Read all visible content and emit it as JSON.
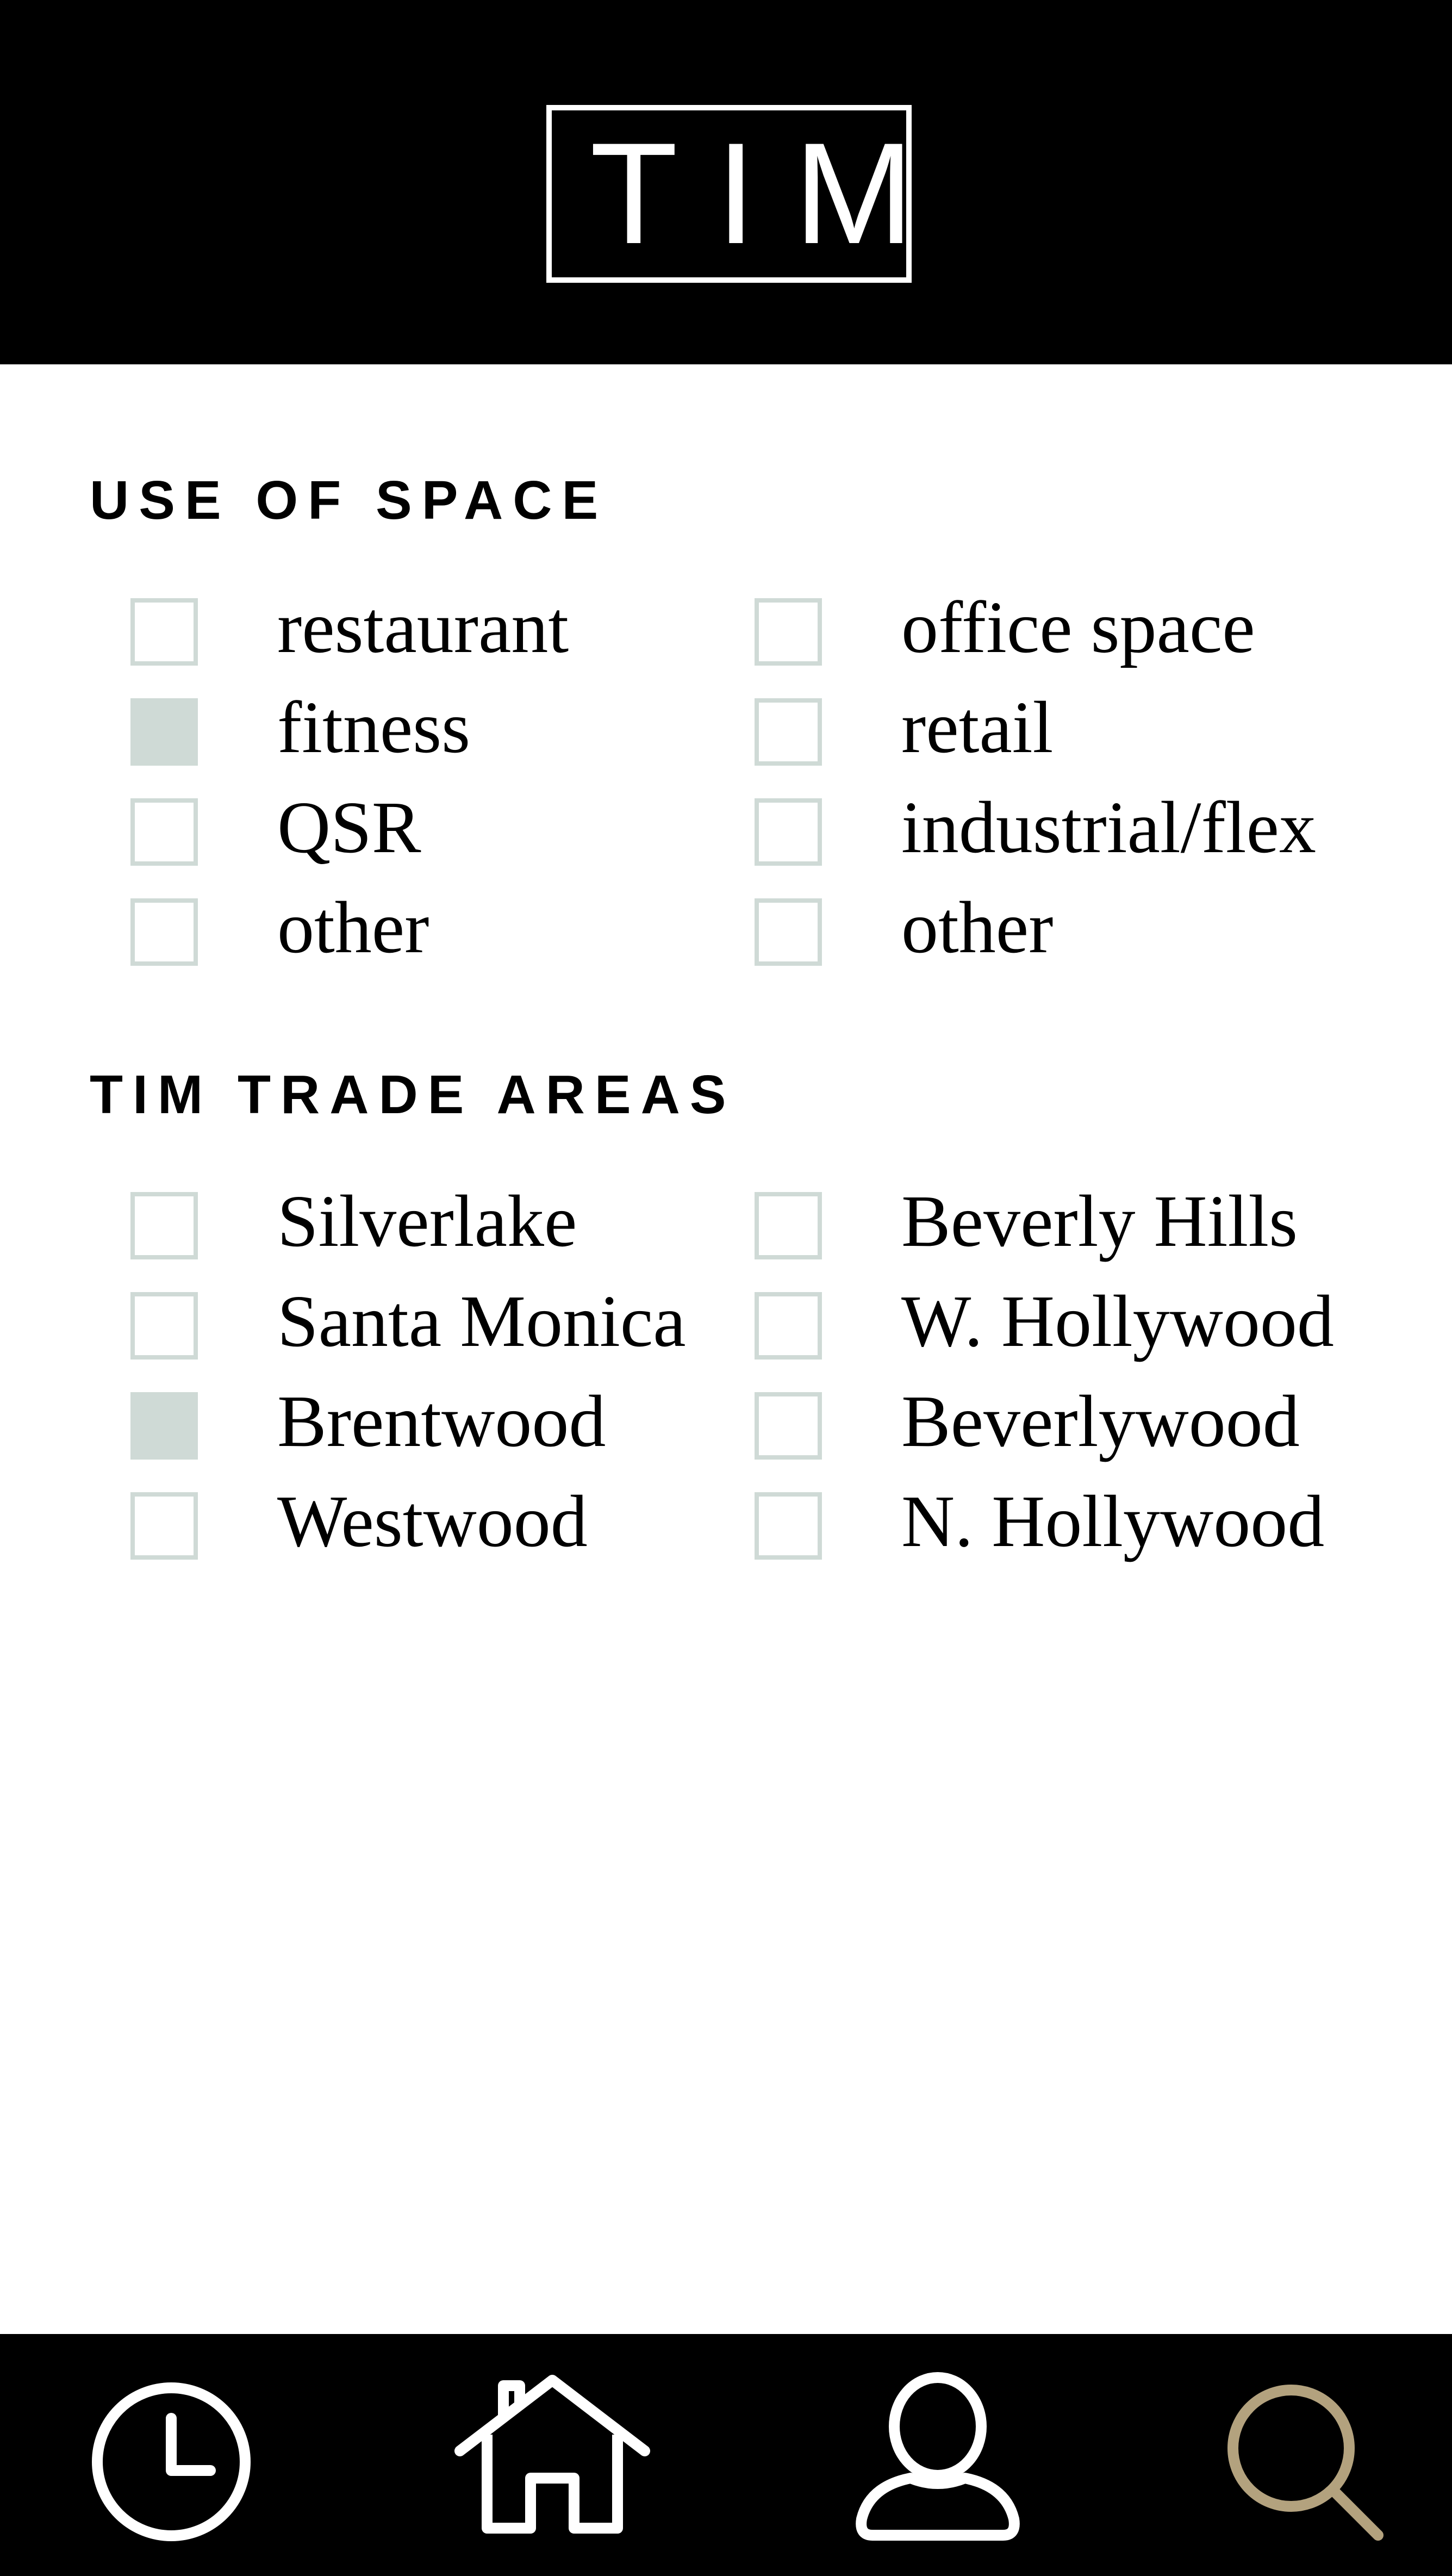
{
  "header": {
    "logo_text": "TIM"
  },
  "use_of_space": {
    "title": "USE OF SPACE",
    "options": [
      {
        "label": "restaurant",
        "checked": false
      },
      {
        "label": "fitness",
        "checked": true
      },
      {
        "label": "QSR",
        "checked": false
      },
      {
        "label": "other",
        "checked": false
      },
      {
        "label": "office space",
        "checked": false
      },
      {
        "label": "retail",
        "checked": false
      },
      {
        "label": "industrial/flex",
        "checked": false
      },
      {
        "label": "other",
        "checked": false
      }
    ]
  },
  "trade_areas": {
    "title": "TIM TRADE AREAS",
    "options": [
      {
        "label": "Silverlake",
        "checked": false
      },
      {
        "label": "Santa Monica",
        "checked": false
      },
      {
        "label": "Brentwood",
        "checked": true
      },
      {
        "label": "Westwood",
        "checked": false
      },
      {
        "label": "Beverly Hills",
        "checked": false
      },
      {
        "label": "W. Hollywood",
        "checked": false
      },
      {
        "label": "Beverlywood",
        "checked": false
      },
      {
        "label": "N. Hollywood",
        "checked": false
      }
    ]
  },
  "bottom_nav": {
    "items": [
      {
        "icon": "clock-icon"
      },
      {
        "icon": "home-icon"
      },
      {
        "icon": "user-icon"
      },
      {
        "icon": "search-icon",
        "active": true
      }
    ],
    "active_color": "#b3a27e",
    "icon_color": "#ffffff"
  },
  "colors": {
    "checkbox": "#cfdad6",
    "header_bg": "#000000"
  }
}
